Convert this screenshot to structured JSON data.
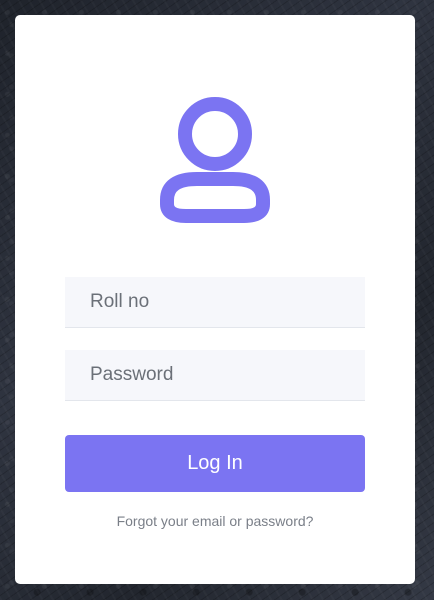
{
  "background": {
    "color": "#262a33"
  },
  "card": {
    "background_color": "#ffffff"
  },
  "avatar": {
    "icon": "user-icon",
    "color": "#7b74f2"
  },
  "form": {
    "roll_placeholder": "Roll no",
    "roll_value": "",
    "password_placeholder": "Password",
    "password_value": "",
    "login_label": "Log In",
    "login_color": "#7b74f2",
    "forgot_label": "Forgot your email or password?"
  }
}
